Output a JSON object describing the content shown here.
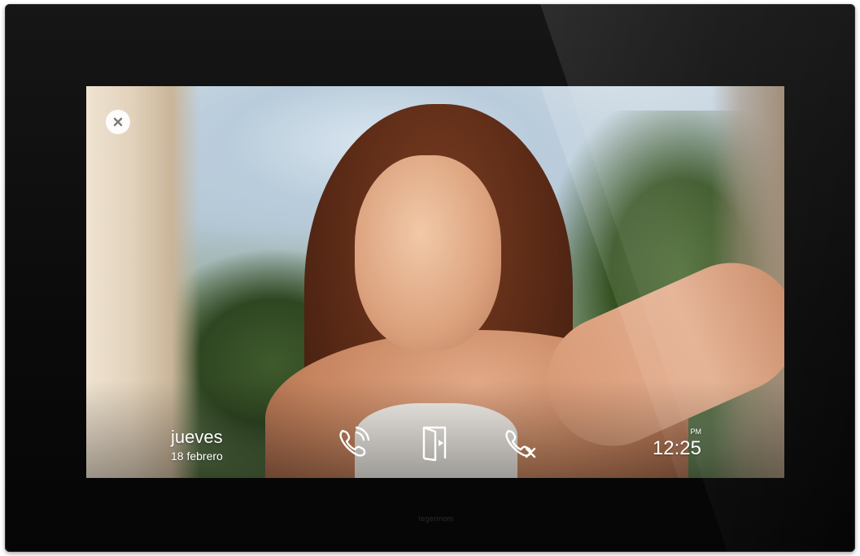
{
  "screen": {
    "close_icon": "close-circle-icon",
    "date": {
      "day": "jueves",
      "date": "18 febrero"
    },
    "time": {
      "ampm": "PM",
      "time": "12:25"
    },
    "actions": [
      {
        "icon": "phone-call-icon"
      },
      {
        "icon": "door-open-icon"
      },
      {
        "icon": "hang-up-icon"
      }
    ]
  },
  "device": {
    "brand": "tegerinom"
  },
  "colors": {
    "device_body": "#0b0b0b",
    "icon_white": "#ffffff"
  }
}
